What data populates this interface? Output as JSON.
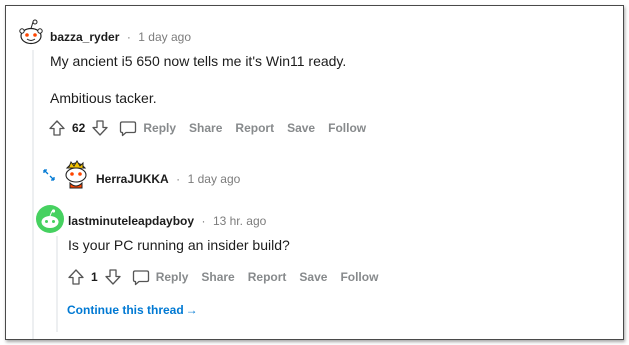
{
  "comments": [
    {
      "username": "bazza_ryder",
      "separator": "·",
      "time": "1 day ago",
      "body": [
        "My ancient i5 650 now tells me it's Win11 ready.",
        "Ambitious tacker."
      ],
      "votes": "62",
      "actions": {
        "reply": "Reply",
        "share": "Share",
        "report": "Report",
        "save": "Save",
        "follow": "Follow"
      }
    },
    {
      "username": "HerraJUKKA",
      "separator": "·",
      "time": "1 day ago",
      "collapsed": true
    },
    {
      "username": "lastminuteleapdayboy",
      "separator": "·",
      "time": "13 hr. ago",
      "body": [
        "Is your PC running an insider build?"
      ],
      "votes": "1",
      "actions": {
        "reply": "Reply",
        "share": "Share",
        "report": "Report",
        "save": "Save",
        "follow": "Follow"
      }
    }
  ],
  "continue_thread": {
    "label": "Continue this thread",
    "arrow": "→"
  },
  "colors": {
    "accent": "#0079d3",
    "muted": "#878a8c",
    "text": "#1c1c1c",
    "thread_line": "#edeff1",
    "avatar_green": "#46d160"
  }
}
